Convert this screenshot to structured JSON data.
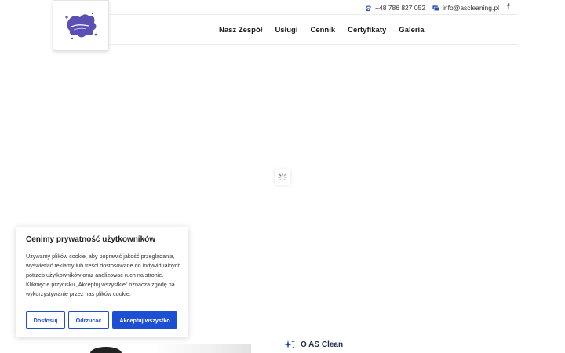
{
  "topbar": {
    "phone": "+48 786 827 052",
    "email": "info@ascleaning.pl",
    "social_icon": "facebook-icon"
  },
  "nav": {
    "items": [
      {
        "label": "Nasz Zespół"
      },
      {
        "label": "Usługi"
      },
      {
        "label": "Cennik"
      },
      {
        "label": "Certyfikaty"
      },
      {
        "label": "Galeria"
      }
    ]
  },
  "cookie": {
    "title": "Cenimy prywatność użytkowników",
    "text": "Używamy plików cookie, aby poprawić jakość przeglądania, wyświetlać reklamy lub treści dostosowane do indywidualnych potrzeb użytkowników oraz analizować ruch na stronie. Kliknięcie przycisku „Akceptuj wszystkie” oznacza zgodę na wykorzystywanie przez nas plików cookie.",
    "btn_customize": "Dostosuj",
    "btn_reject": "Odrzucać",
    "btn_accept": "Akceptuj wszystko"
  },
  "about": {
    "heading": "O AS Clean"
  },
  "colors": {
    "accent": "#1d4fd2",
    "logo": "#5a4fb3",
    "heading_dark": "#1f2a4a"
  }
}
